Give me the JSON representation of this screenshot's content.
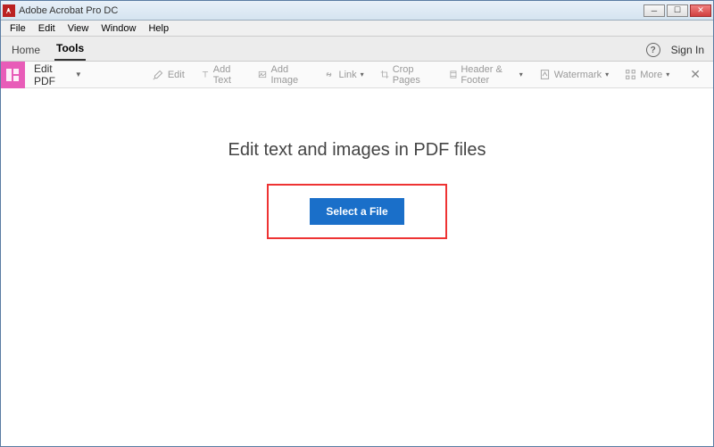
{
  "window": {
    "title": "Adobe Acrobat Pro DC"
  },
  "menubar": {
    "file": "File",
    "edit": "Edit",
    "view": "View",
    "window": "Window",
    "help": "Help"
  },
  "tabs": {
    "home": "Home",
    "tools": "Tools",
    "signin": "Sign In"
  },
  "toolbar": {
    "label": "Edit PDF",
    "edit": "Edit",
    "addtext": "Add Text",
    "addimage": "Add Image",
    "link": "Link",
    "croppages": "Crop Pages",
    "headerfooter": "Header & Footer",
    "watermark": "Watermark",
    "more": "More"
  },
  "main": {
    "headline": "Edit text and images in PDF files",
    "selectfile": "Select a File"
  }
}
